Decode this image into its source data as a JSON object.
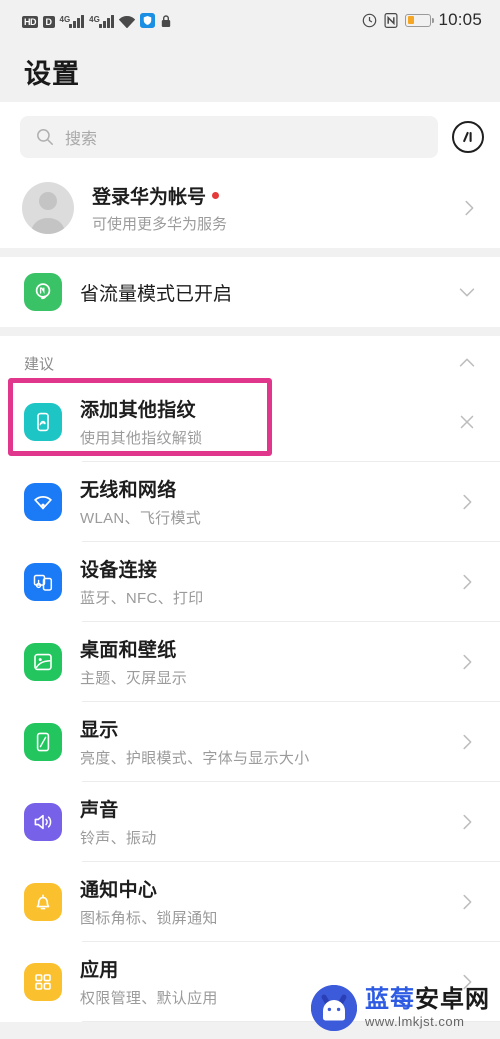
{
  "statusbar": {
    "hd_label": "HD",
    "sim_label": "D",
    "network_label_1": "4G",
    "network_label_2": "4G",
    "icons": [
      "hd-icon",
      "sim-icon",
      "signal-4g-icon-1",
      "signal-4g-icon-2",
      "wifi-icon",
      "shield-icon",
      "lock-icon",
      "alarm-icon",
      "nfc-icon",
      "battery-icon"
    ],
    "clock": "10:05"
  },
  "header": {
    "title": "设置"
  },
  "search": {
    "placeholder": "搜索",
    "icon": "search-icon",
    "assistant_icon": "smart-assist-icon"
  },
  "account": {
    "title": "登录华为帐号",
    "subtitle": "可使用更多华为服务",
    "has_red_dot": true,
    "avatar_icon": "avatar-placeholder-icon",
    "chevron": "chevron-right-icon"
  },
  "data_saver": {
    "title": "省流量模式已开启",
    "icon": "leaf-data-saver-icon",
    "icon_color": "#3ac267",
    "chevron": "chevron-down-icon"
  },
  "suggestions": {
    "section_title": "建议",
    "collapse_icon": "chevron-up-icon",
    "items": [
      {
        "title": "添加其他指纹",
        "subtitle": "使用其他指纹解锁",
        "icon": "fingerprint-icon",
        "icon_color": "#1ec5c5",
        "close_icon": "close-icon",
        "highlighted": true,
        "highlight_color": "#e0368c"
      }
    ]
  },
  "settings_list": [
    {
      "title": "无线和网络",
      "subtitle": "WLAN、飞行模式",
      "icon": "wifi-icon",
      "icon_color": "#1b7af5",
      "chevron": "chevron-right-icon"
    },
    {
      "title": "设备连接",
      "subtitle": "蓝牙、NFC、打印",
      "icon": "device-connection-icon",
      "icon_color": "#1b7af5",
      "chevron": "chevron-right-icon"
    },
    {
      "title": "桌面和壁纸",
      "subtitle": "主题、灭屏显示",
      "icon": "wallpaper-icon",
      "icon_color": "#22c55e",
      "chevron": "chevron-right-icon"
    },
    {
      "title": "显示",
      "subtitle": "亮度、护眼模式、字体与显示大小",
      "icon": "display-icon",
      "icon_color": "#22c55e",
      "chevron": "chevron-right-icon"
    },
    {
      "title": "声音",
      "subtitle": "铃声、振动",
      "icon": "sound-icon",
      "icon_color": "#7661e8",
      "chevron": "chevron-right-icon"
    },
    {
      "title": "通知中心",
      "subtitle": "图标角标、锁屏通知",
      "icon": "bell-icon",
      "icon_color": "#fbc02d",
      "chevron": "chevron-right-icon"
    },
    {
      "title": "应用",
      "subtitle": "权限管理、默认应用",
      "icon": "apps-grid-icon",
      "icon_color": "#fbc02d",
      "chevron": "chevron-right-icon"
    }
  ],
  "watermark": {
    "brand_blue": "蓝莓",
    "brand_dark": "安卓网",
    "url": "www.lmkjst.com",
    "logo_icon": "android-mascot-icon"
  }
}
